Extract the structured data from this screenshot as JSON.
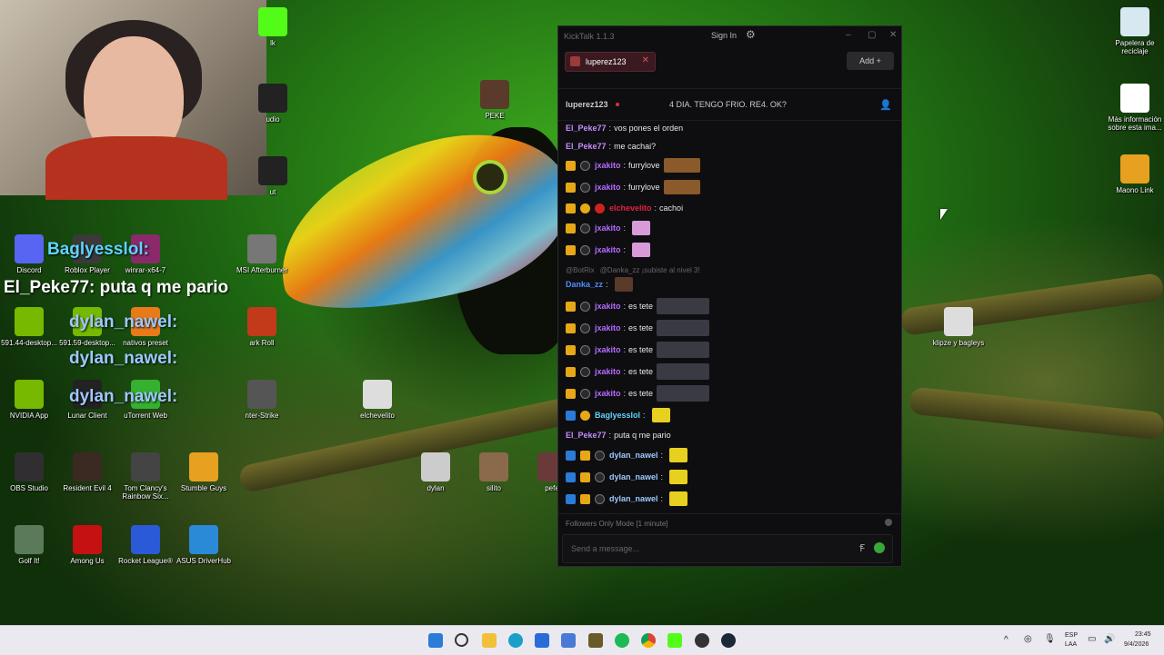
{
  "window": {
    "app_title": "KickTalk 1.1.3",
    "sign_in": "Sign In",
    "tab_label": "luperez123",
    "add_label": "Add",
    "channel_user": "luperez123",
    "stream_title": "4 DIA. TENGO FRIO. RE4. OK?",
    "followers_mode": "Followers Only Mode [1 minute]",
    "input_placeholder": "Send a message...",
    "accent": "#53fc18"
  },
  "messages": [
    {
      "user": "El_Peke77",
      "color": "#c58cff",
      "badges": [],
      "text": "vos pones el orden"
    },
    {
      "user": "El_Peke77",
      "color": "#c58cff",
      "badges": [],
      "text": "me cachai?"
    },
    {
      "user": "jxakito",
      "color": "#b36cff",
      "badges": [
        "crown",
        "sun"
      ],
      "text": "furrylove",
      "emote": "#8a5a2a"
    },
    {
      "user": "jxakito",
      "color": "#b36cff",
      "badges": [
        "crown",
        "sun"
      ],
      "text": "furrylove",
      "emote": "#8a5a2a"
    },
    {
      "user": "elchevelito",
      "color": "#e0233f",
      "badges": [
        "crown",
        "one",
        "red"
      ],
      "text": "cachoi"
    },
    {
      "user": "jxakito",
      "color": "#b36cff",
      "badges": [
        "crown",
        "sun"
      ],
      "text": "",
      "emote": "#d89ad8"
    },
    {
      "user": "jxakito",
      "color": "#b36cff",
      "badges": [
        "crown",
        "sun"
      ],
      "text": "",
      "emote": "#d89ad8"
    },
    {
      "user": "@BotRix",
      "color": "#666",
      "badges": [],
      "text": "@Danka_zz ¡subiste al nivel 3!",
      "system": true
    },
    {
      "user": "Danka_zz",
      "color": "#4d8cff",
      "badges": [],
      "text": "",
      "emote": "#5a3a2a"
    },
    {
      "user": "jxakito",
      "color": "#b36cff",
      "badges": [
        "crown",
        "sun"
      ],
      "text": "es tete",
      "emote": "#3a3a44"
    },
    {
      "user": "jxakito",
      "color": "#b36cff",
      "badges": [
        "crown",
        "sun"
      ],
      "text": "es tete",
      "emote": "#3a3a44"
    },
    {
      "user": "jxakito",
      "color": "#b36cff",
      "badges": [
        "crown",
        "sun"
      ],
      "text": "es tete",
      "emote": "#3a3a44"
    },
    {
      "user": "jxakito",
      "color": "#b36cff",
      "badges": [
        "crown",
        "sun"
      ],
      "text": "es tete",
      "emote": "#3a3a44"
    },
    {
      "user": "jxakito",
      "color": "#b36cff",
      "badges": [
        "crown",
        "sun"
      ],
      "text": "es tete",
      "emote": "#3a3a44"
    },
    {
      "user": "Baglyesslol",
      "color": "#5fd3ff",
      "badges": [
        "blue",
        "one"
      ],
      "text": "",
      "emote": "#e8d020"
    },
    {
      "user": "El_Peke77",
      "color": "#c58cff",
      "badges": [],
      "text": "puta q me pario"
    },
    {
      "user": "dylan_nawel",
      "color": "#9ec8ff",
      "badges": [
        "blue",
        "crown",
        "sun"
      ],
      "text": "",
      "emote": "#e8d020"
    },
    {
      "user": "dylan_nawel",
      "color": "#9ec8ff",
      "badges": [
        "blue",
        "crown",
        "sun"
      ],
      "text": "",
      "emote": "#e8d020"
    },
    {
      "user": "dylan_nawel",
      "color": "#9ec8ff",
      "badges": [
        "blue",
        "crown",
        "sun"
      ],
      "text": "",
      "emote": "#e8d020"
    }
  ],
  "overlay": {
    "line1": "Baglyesslol:",
    "line2": "El_Peke77: puta q me pario",
    "line3": "dylan_nawel:",
    "line4": "dylan_nawel:",
    "line5": "dylan_nawel:"
  },
  "desktop_icons": [
    {
      "label": "Discord",
      "color": "#5865f2"
    },
    {
      "label": "Roblox Player",
      "color": "#3a3a3a"
    },
    {
      "label": "winrar-x64-7",
      "color": "#8a2a6a"
    },
    {
      "label": "MSI Afterburner",
      "color": "#777"
    },
    {
      "label": "591.44-desktop...",
      "color": "#76b900"
    },
    {
      "label": "591.59-desktop...",
      "color": "#76b900"
    },
    {
      "label": "nativos preset",
      "color": "#e87a1a"
    },
    {
      "label": "ark Roll",
      "color": "#c23a1a"
    },
    {
      "label": "NVIDIA App",
      "color": "#76b900"
    },
    {
      "label": "Lunar Client",
      "color": "#222"
    },
    {
      "label": "uTorrent Web",
      "color": "#35b030"
    },
    {
      "label": "nter-Strike",
      "color": "#555"
    },
    {
      "label": "OBS Studio",
      "color": "#302e31"
    },
    {
      "label": "Resident Evil 4",
      "color": "#3a2a22"
    },
    {
      "label": "Tom Clancy's Rainbow Six...",
      "color": "#444"
    },
    {
      "label": "Stumble Guys",
      "color": "#e8a020"
    },
    {
      "label": "Golf It!",
      "color": "#5a7a5a"
    },
    {
      "label": "Among Us",
      "color": "#c51111"
    },
    {
      "label": "Rocket League®",
      "color": "#2a5ad8"
    },
    {
      "label": "ASUS DriverHub",
      "color": "#2a8ad8"
    },
    {
      "label": "PEKE",
      "color": "#5a3a2a"
    },
    {
      "label": "elchevelito",
      "color": "#ddd"
    },
    {
      "label": "dylan",
      "color": "#ccc"
    },
    {
      "label": "silito",
      "color": "#8a6a4a"
    },
    {
      "label": "pefe",
      "color": "#6a3a3a"
    },
    {
      "label": "Papelera de reciclaje",
      "color": "#d8e8f0"
    },
    {
      "label": "Más información sobre esta ima...",
      "color": "#fff"
    },
    {
      "label": "Maono Link",
      "color": "#e8a020"
    },
    {
      "label": "klipze y bagleys",
      "color": "#ddd"
    },
    {
      "label": "udio",
      "color": "#222"
    },
    {
      "label": "ut",
      "color": "#222"
    },
    {
      "label": "lk",
      "color": "#53fc18"
    }
  ],
  "taskbar": {
    "lang_top": "ESP",
    "lang_bottom": "LAA",
    "time": "23:45",
    "date": "9/4/2026"
  }
}
